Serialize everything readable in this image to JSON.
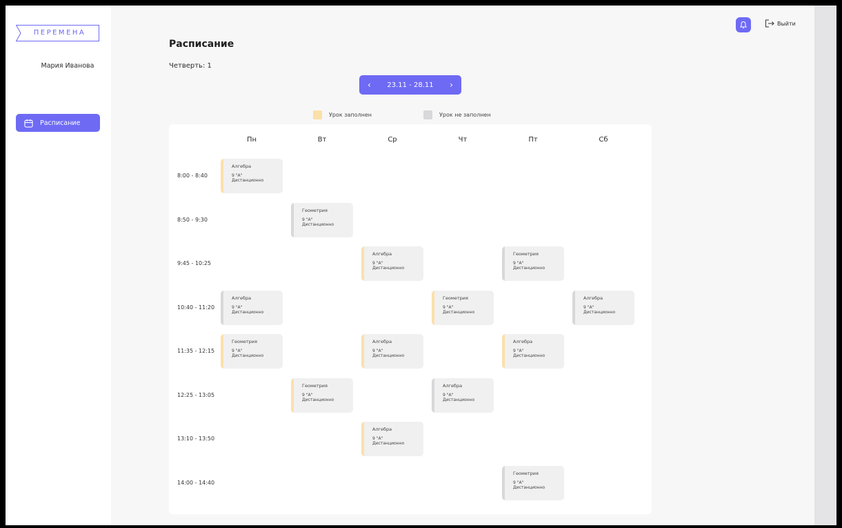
{
  "app": {
    "logo_text": "ПЕРЕМЕНА",
    "user_name": "Мария Иванова"
  },
  "sidebar": {
    "items": [
      {
        "label": "Расписание",
        "icon": "calendar-icon",
        "active": true
      }
    ]
  },
  "header": {
    "logout_label": "Выйти",
    "bell_icon": "bell-icon"
  },
  "main": {
    "title": "Расписание",
    "quarter_label": "Четверть: 1",
    "week_range": "23.11 - 28.11",
    "legend": {
      "filled_label": "Урок заполнен",
      "empty_label": "Урок не заполнен",
      "filled_color": "#fbe0a9",
      "empty_color": "#d8d8da"
    },
    "days": [
      "Пн",
      "Вт",
      "Ср",
      "Чт",
      "Пт",
      "Сб"
    ],
    "times": [
      "8:00 - 8:40",
      "8:50 - 9:30",
      "9:45 - 10:25",
      "10:40 - 11:20",
      "11:35 - 12:15",
      "12:25 - 13:05",
      "13:10 - 13:50",
      "14:00 - 14:40"
    ],
    "lessons": [
      {
        "day": 0,
        "slot": 0,
        "subject": "Алгебра",
        "class": "9 \"А\"",
        "mode": "Дистанционно",
        "filled": true
      },
      {
        "day": 1,
        "slot": 1,
        "subject": "Геометрия",
        "class": "9 \"А\"",
        "mode": "Дистанционно",
        "filled": false
      },
      {
        "day": 2,
        "slot": 2,
        "subject": "Алгебра",
        "class": "9 \"А\"",
        "mode": "Дистанционно",
        "filled": true
      },
      {
        "day": 4,
        "slot": 2,
        "subject": "Геометрия",
        "class": "9 \"А\"",
        "mode": "Дистанционно",
        "filled": false
      },
      {
        "day": 0,
        "slot": 3,
        "subject": "Алгебра",
        "class": "9 \"А\"",
        "mode": "Дистанционно",
        "filled": false
      },
      {
        "day": 3,
        "slot": 3,
        "subject": "Геометрия",
        "class": "9 \"А\"",
        "mode": "Дистанционно",
        "filled": true
      },
      {
        "day": 5,
        "slot": 3,
        "subject": "Алгебра",
        "class": "9 \"А\"",
        "mode": "Дистанционно",
        "filled": false
      },
      {
        "day": 0,
        "slot": 4,
        "subject": "Геометрия",
        "class": "9 \"А\"",
        "mode": "Дистанционно",
        "filled": true
      },
      {
        "day": 2,
        "slot": 4,
        "subject": "Алгебра",
        "class": "9 \"А\"",
        "mode": "Дистанционно",
        "filled": true
      },
      {
        "day": 4,
        "slot": 4,
        "subject": "Алгебра",
        "class": "9 \"А\"",
        "mode": "Дистанционно",
        "filled": true
      },
      {
        "day": 1,
        "slot": 5,
        "subject": "Геометрия",
        "class": "9 \"А\"",
        "mode": "Дистанционно",
        "filled": true
      },
      {
        "day": 3,
        "slot": 5,
        "subject": "Алгебра",
        "class": "9 \"А\"",
        "mode": "Дистанционно",
        "filled": false
      },
      {
        "day": 2,
        "slot": 6,
        "subject": "Алгебра",
        "class": "9 \"А\"",
        "mode": "Дистанционно",
        "filled": true
      },
      {
        "day": 4,
        "slot": 7,
        "subject": "Геометрия",
        "class": "9 \"А\"",
        "mode": "Дистанционно",
        "filled": false
      }
    ]
  },
  "colors": {
    "accent": "#6e6af4",
    "background": "#f7f7f8"
  }
}
